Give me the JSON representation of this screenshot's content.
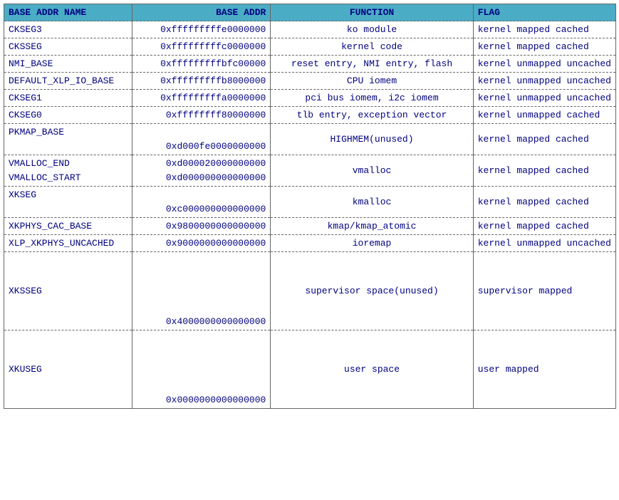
{
  "headers": {
    "col1": "BASE ADDR NAME",
    "col2": "BASE ADDR",
    "col3": "FUNCTION",
    "col4": "FLAG"
  },
  "rows": [
    {
      "name": "CKSEG3",
      "addr": "0xfffffffffe0000000",
      "func": "ko module",
      "flag": "kernel mapped cached"
    },
    {
      "name": "CKSSEG",
      "addr": "0xfffffffffc0000000",
      "func": "kernel code",
      "flag": "kernel mapped cached"
    },
    {
      "name": "NMI_BASE",
      "addr": "0xfffffffffbfc00000",
      "func": "reset entry, NMI entry, flash",
      "flag": "kernel unmapped uncached"
    },
    {
      "name": "DEFAULT_XLP_IO_BASE",
      "addr": "0xfffffffffb8000000",
      "func": "CPU iomem",
      "flag": "kernel unmapped uncached"
    },
    {
      "name": "CKSEG1",
      "addr": "0xfffffffffa0000000",
      "func": "pci bus iomem, i2c iomem",
      "flag": "kernel unmapped uncached"
    },
    {
      "name": "CKSEG0",
      "addr": "0xffffffff80000000",
      "func": "tlb entry, exception vector",
      "flag": "kernel unmapped cached"
    },
    {
      "name": "PKMAP_BASE",
      "addr": "0xd000fe0000000000",
      "func": "HIGHMEM(unused)",
      "flag": "kernel mapped cached"
    },
    {
      "name1": "VMALLOC_END",
      "name2": "VMALLOC_START",
      "addr1": "0xd000020000000000",
      "addr2": "0xd000000000000000",
      "func": "vmalloc",
      "flag": "kernel mapped cached"
    },
    {
      "name": "XKSEG",
      "addr": "0xc000000000000000",
      "func": "kmalloc",
      "flag": "kernel mapped cached"
    },
    {
      "name": "XKPHYS_CAC_BASE",
      "addr": "0x9800000000000000",
      "func": "kmap/kmap_atomic",
      "flag": "kernel mapped cached"
    },
    {
      "name": "XLP_XKPHYS_UNCACHED",
      "addr": "0x9000000000000000",
      "func": "ioremap",
      "flag": "kernel unmapped uncached"
    },
    {
      "name": "XKSSEG",
      "addr": "0x4000000000000000",
      "func": "supervisor space(unused)",
      "flag": "supervisor mapped"
    },
    {
      "name": "XKUSEG",
      "addr": "0x0000000000000000",
      "func": "user space",
      "flag": "user mapped"
    }
  ]
}
